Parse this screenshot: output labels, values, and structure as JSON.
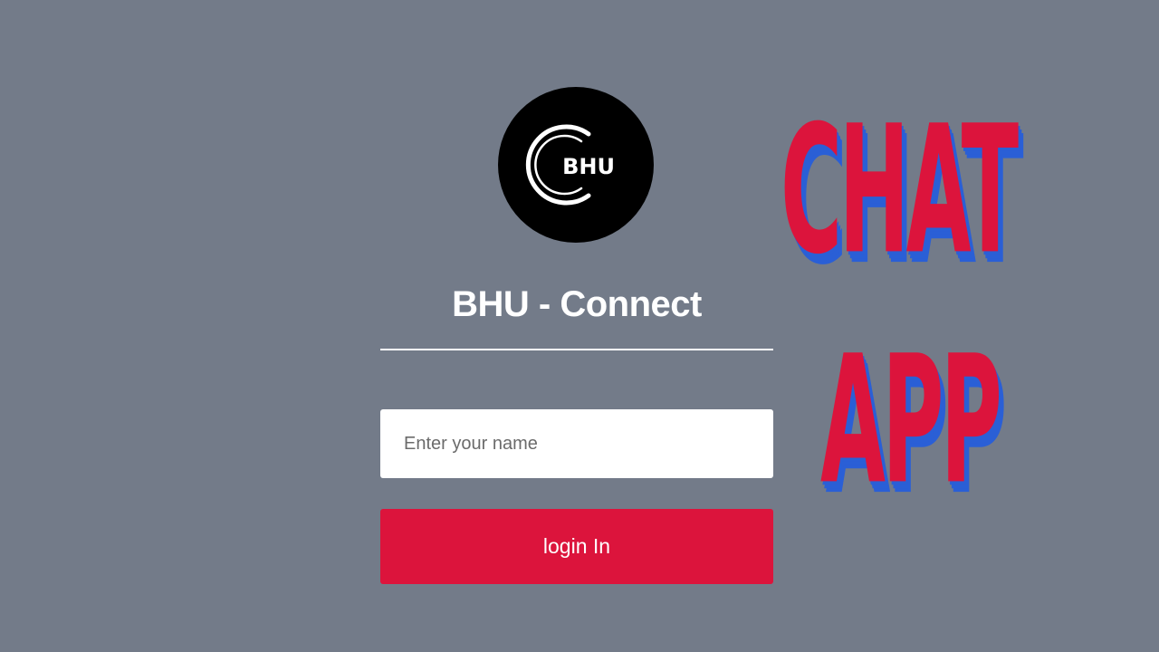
{
  "brand": {
    "logo_text": "BHU",
    "title": "BHU - Connect"
  },
  "login_form": {
    "name_placeholder": "Enter your name",
    "name_value": "",
    "submit_label": "login In"
  },
  "promo": {
    "line1": "CHAT",
    "line2": "APP"
  },
  "colors": {
    "background": "#737b89",
    "accent": "#dc143c",
    "promo_shadow": "#2a5fd6",
    "logo_bg": "#000000"
  }
}
